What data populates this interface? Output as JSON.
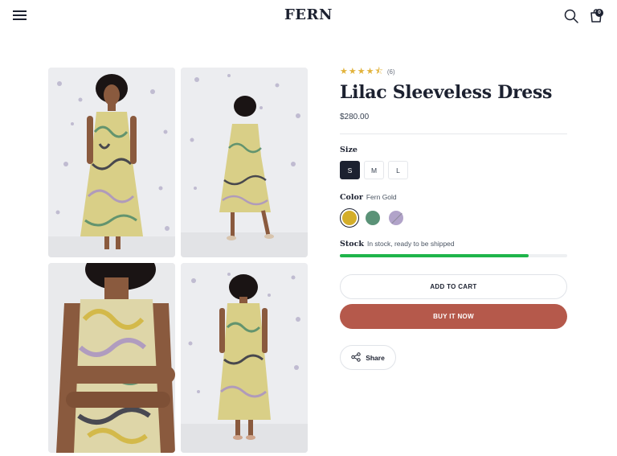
{
  "header": {
    "logo": "FERN",
    "cart_count": "0",
    "menu_icon": "hamburger-menu-icon",
    "search_icon": "search-icon",
    "cart_icon": "shopping-bag-icon"
  },
  "gallery": {
    "images": [
      {
        "name": "model-front-full-body"
      },
      {
        "name": "model-side-full-body"
      },
      {
        "name": "model-closeup-arms-crossed"
      },
      {
        "name": "model-back-full-body"
      }
    ]
  },
  "product": {
    "rating": 4.5,
    "stars": "★★★★⯪",
    "review_count": "(6)",
    "title": "Lilac Sleeveless Dress",
    "price": "$280.00",
    "size": {
      "label": "Size",
      "options": [
        "S",
        "M",
        "L"
      ],
      "selected": "S"
    },
    "color": {
      "label": "Color",
      "selected_name": "Fern Gold",
      "swatches": [
        {
          "name": "Fern Gold",
          "hex": "#d4ae2a",
          "selected": true,
          "available": true
        },
        {
          "name": "Green",
          "hex": "#5a9277",
          "selected": false,
          "available": true
        },
        {
          "name": "Lilac",
          "hex": "#b1a3c9",
          "selected": false,
          "available": false
        }
      ]
    },
    "stock": {
      "label": "Stock",
      "text": "In stock, ready to be shipped",
      "level": 0.83,
      "color": "#1fb44a"
    },
    "add_to_cart": "ADD TO CART",
    "buy_now": "BUY IT NOW",
    "buy_color": "#b5594b",
    "share": "Share",
    "share_icon": "share-icon"
  },
  "colors": {
    "text": "#1c2130",
    "star": "#e2b33c"
  }
}
